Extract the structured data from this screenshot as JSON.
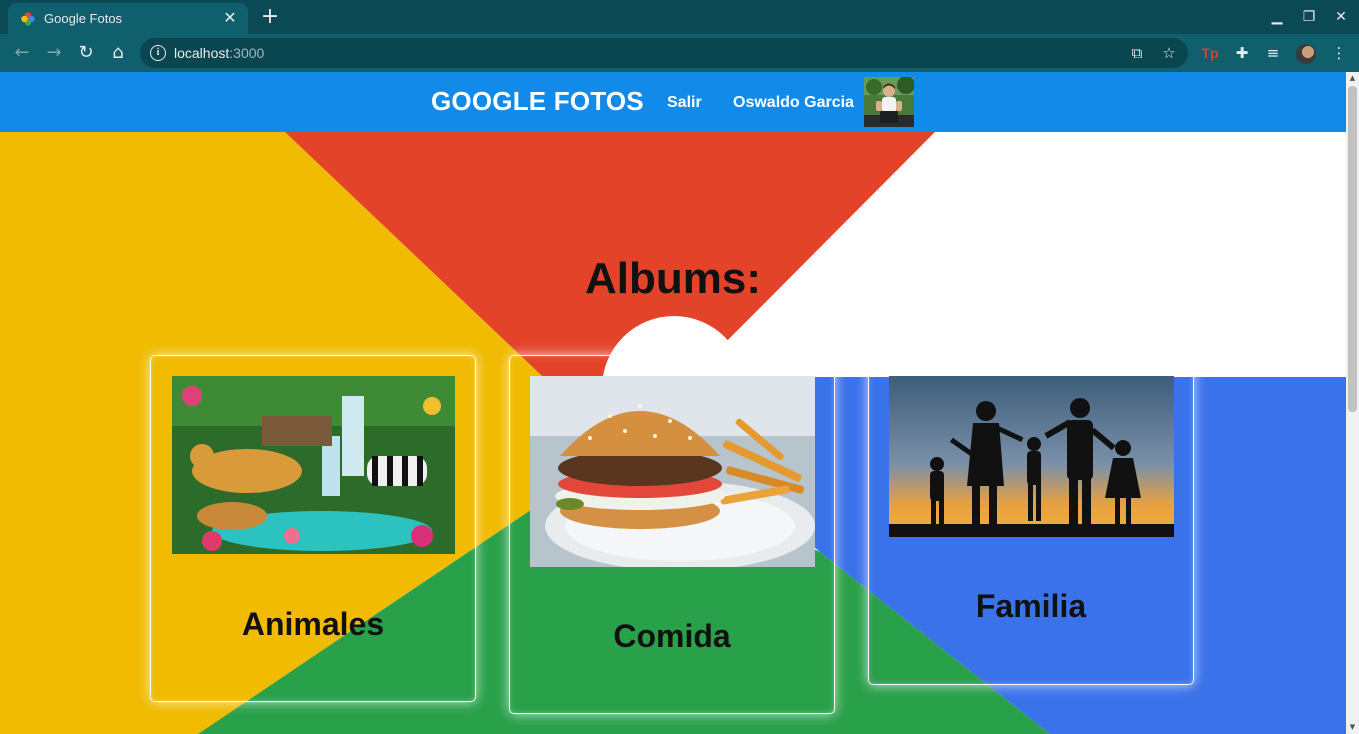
{
  "browser": {
    "tab_title": "Google Fotos",
    "url_host": "localhost",
    "url_port": ":3000",
    "icons": [
      "google-photos-favicon",
      "close-icon",
      "plus-icon",
      "minimize-icon",
      "restore-icon",
      "close-window-icon",
      "back-arrow-icon",
      "forward-arrow-icon",
      "reload-icon",
      "home-icon",
      "info-icon",
      "translate-icon",
      "star-icon",
      "tp-extension-icon",
      "puzzle-icon",
      "media-queue-icon",
      "profile-avatar",
      "kebab-menu-icon"
    ]
  },
  "navbar": {
    "brand": "GOOGLE FOTOS",
    "logout": "Salir",
    "user_name": "Oswaldo Garcia"
  },
  "main": {
    "heading": "Albums:",
    "albums": [
      {
        "title": "Animales",
        "image": "jungle-animals-photo"
      },
      {
        "title": "Comida",
        "image": "burger-photo"
      },
      {
        "title": "Familia",
        "image": "family-silhouette-photo"
      }
    ]
  },
  "colors": {
    "navbar": "#128aea",
    "yellow": "#f0bb00",
    "red": "#e34329",
    "green": "#29a04a",
    "blue": "#3a72ea",
    "chrome_dark": "#0b4a55",
    "chrome_toolbar": "#0f5f6d"
  }
}
